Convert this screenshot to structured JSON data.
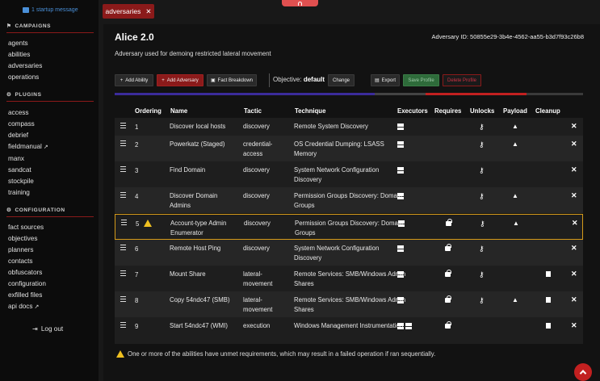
{
  "sidebar": {
    "startup_message": "1 startup message",
    "campaigns_header": "CAMPAIGNS",
    "campaigns": [
      "agents",
      "abilities",
      "adversaries",
      "operations"
    ],
    "plugins_header": "PLUGINS",
    "plugins": [
      "access",
      "compass",
      "debrief",
      "fieldmanual",
      "manx",
      "sandcat",
      "stockpile",
      "training"
    ],
    "configuration_header": "CONFIGURATION",
    "configuration": [
      "fact sources",
      "objectives",
      "planners",
      "contacts",
      "obfuscators",
      "configuration",
      "exfilled files",
      "api docs"
    ],
    "logout": "Log out"
  },
  "tab": {
    "label": "adversaries"
  },
  "adversary": {
    "name": "Alice 2.0",
    "id_label": "Adversary ID: 50855e29-3b4e-4562-aa55-b3d7f93c26b8",
    "description": "Adversary used for demoing restricted lateral movement",
    "objective_label": "Objective:",
    "objective_value": "default"
  },
  "toolbar": {
    "add_ability": "Add Ability",
    "add_adversary": "Add Adversary",
    "fact_breakdown": "Fact Breakdown",
    "change": "Change",
    "export": "Export",
    "save_profile": "Save Profile",
    "delete_profile": "Delete Profile"
  },
  "table": {
    "headers": [
      "Ordering",
      "Name",
      "Tactic",
      "Technique",
      "Executors",
      "Requires",
      "Unlocks",
      "Payload",
      "Cleanup"
    ],
    "rows": [
      {
        "order": "1",
        "name": "Discover local hosts",
        "tactic": "discovery",
        "technique": "Remote System Discovery"
      },
      {
        "order": "2",
        "name": "Powerkatz (Staged)",
        "tactic": "credential-access",
        "technique": "OS Credential Dumping: LSASS Memory"
      },
      {
        "order": "3",
        "name": "Find Domain",
        "tactic": "discovery",
        "technique": "System Network Configuration Discovery"
      },
      {
        "order": "4",
        "name": "Discover Domain Admins",
        "tactic": "discovery",
        "technique": "Permission Groups Discovery: Domain Groups"
      },
      {
        "order": "5",
        "name": "Account-type Admin Enumerator",
        "tactic": "discovery",
        "technique": "Permission Groups Discovery: Domain Groups"
      },
      {
        "order": "6",
        "name": "Remote Host Ping",
        "tactic": "discovery",
        "technique": "System Network Configuration Discovery"
      },
      {
        "order": "7",
        "name": "Mount Share",
        "tactic": "lateral-movement",
        "technique": "Remote Services: SMB/Windows Admin Shares"
      },
      {
        "order": "8",
        "name": "Copy 54ndc47 (SMB)",
        "tactic": "lateral-movement",
        "technique": "Remote Services: SMB/Windows Admin Shares"
      },
      {
        "order": "9",
        "name": "Start 54ndc47 (WMI)",
        "tactic": "execution",
        "technique": "Windows Management Instrumentation"
      }
    ]
  },
  "footer_warning": "One or more of the abilities have unmet requirements, which may result in a failed operation if ran sequentially.",
  "colors": {
    "accent": "#8b1a1a",
    "warning": "#d49a1a",
    "progress_blue": "#3b2b9b",
    "progress_red": "#c22020"
  }
}
